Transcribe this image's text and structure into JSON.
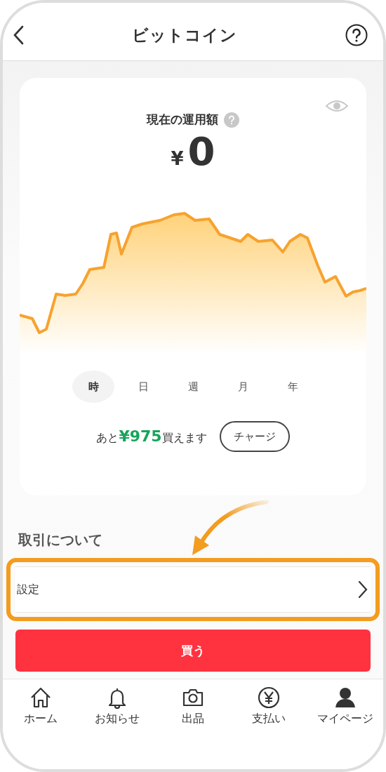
{
  "header": {
    "title": "ビットコイン"
  },
  "card": {
    "label": "現在の運用額",
    "currency": "¥",
    "amount": "0",
    "periods": [
      {
        "label": "時",
        "selected": true
      },
      {
        "label": "日",
        "selected": false
      },
      {
        "label": "週",
        "selected": false
      },
      {
        "label": "月",
        "selected": false
      },
      {
        "label": "年",
        "selected": false
      }
    ],
    "remaining": "あと**¥975**買えます",
    "charge_button": "チャージ"
  },
  "section_title": "取引について",
  "settings_row": {
    "label": "設定",
    "highlighted": true
  },
  "buy_button": "買う",
  "nav": [
    {
      "label": "ホーム",
      "kind": "home"
    },
    {
      "label": "お知らせ",
      "kind": "bell"
    },
    {
      "label": "出品",
      "kind": "camera"
    },
    {
      "label": "支払い",
      "kind": "yen"
    },
    {
      "label": "マイページ",
      "kind": "person"
    }
  ]
}
